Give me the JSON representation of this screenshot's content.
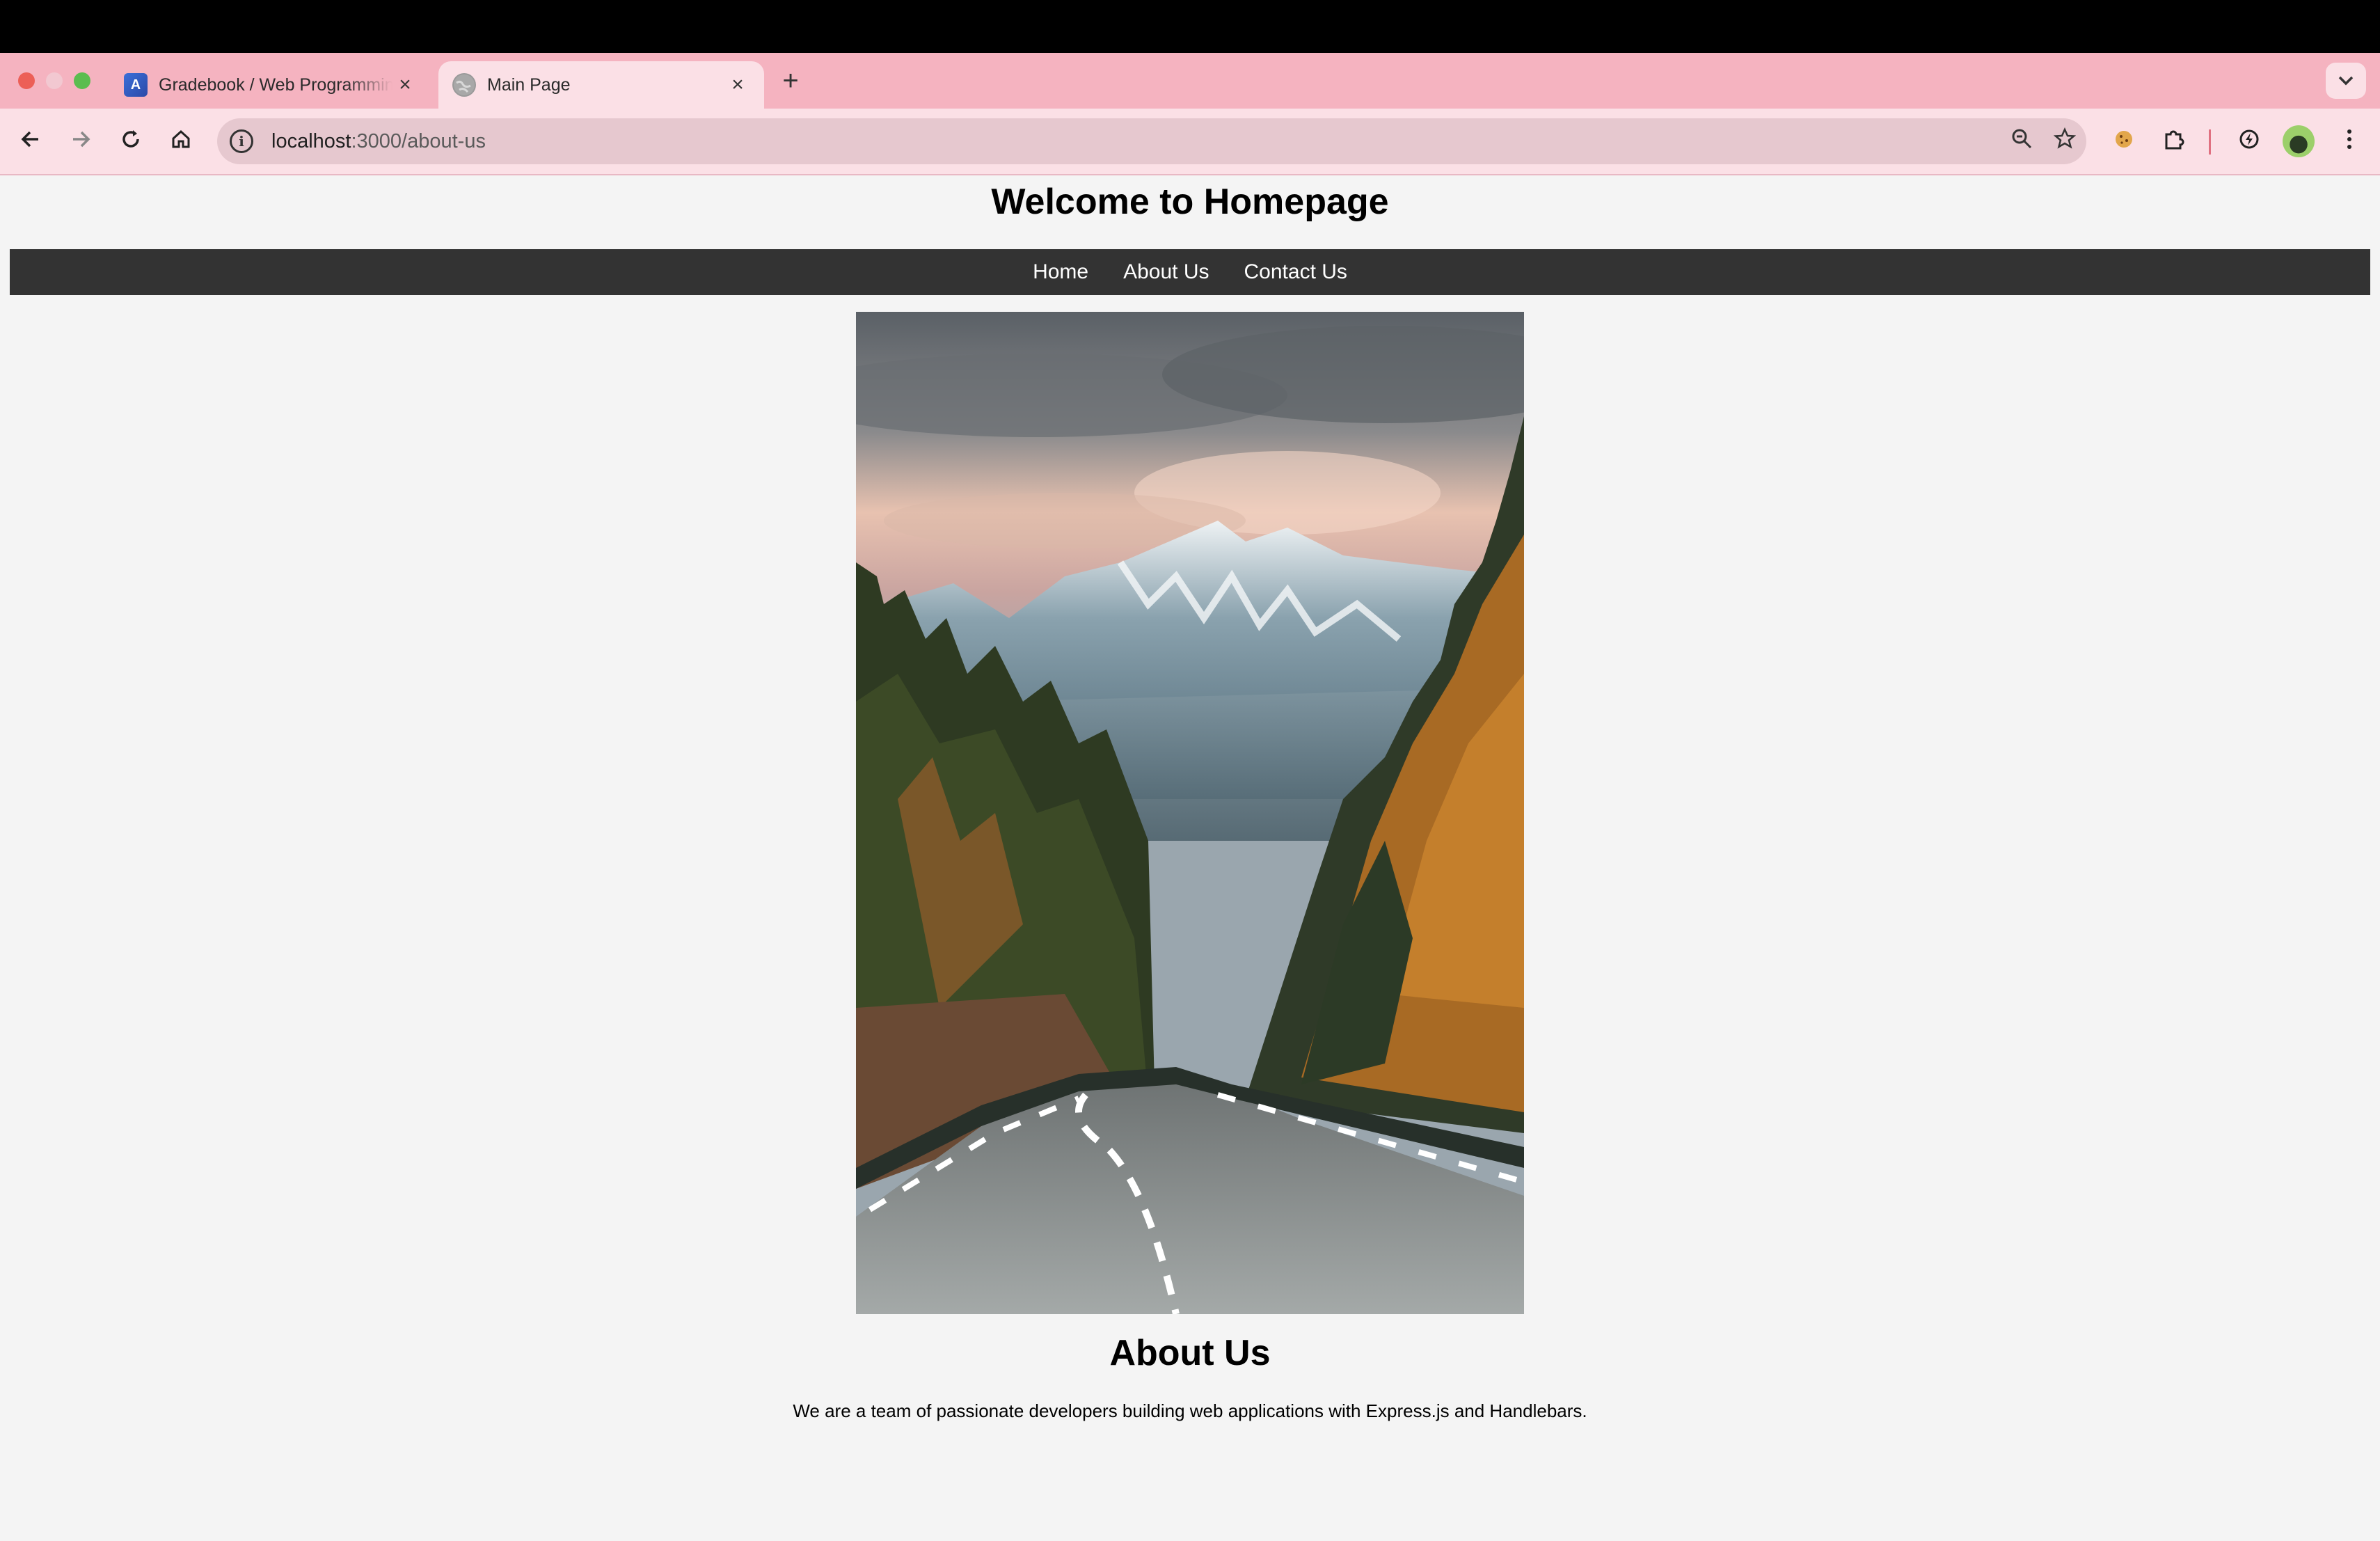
{
  "browser": {
    "tabs": [
      {
        "title": "Gradebook / Web Programmin",
        "favicon": "A",
        "active": false
      },
      {
        "title": "Main Page",
        "favicon": "globe",
        "active": true
      }
    ],
    "url_host": "localhost",
    "url_path": ":3000/about-us",
    "icons": {
      "back": "←",
      "forward": "→",
      "reload": "↻",
      "home": "⌂",
      "zoom": "🔍",
      "bookmark": "☆",
      "cookie": "🍪",
      "extensions": "⧉",
      "performance": "⚡",
      "menu": "⋮",
      "new_tab": "+",
      "tab_search": "⌄",
      "close": "×"
    }
  },
  "page": {
    "site_title": "Welcome to Homepage",
    "nav": [
      {
        "label": "Home"
      },
      {
        "label": "About Us"
      },
      {
        "label": "Contact Us"
      }
    ],
    "hero_image": "mountain-road-forest-photo",
    "about": {
      "title": "About Us",
      "text": "We are a team of passionate developers building web applications with Express.js and Handlebars."
    }
  }
}
